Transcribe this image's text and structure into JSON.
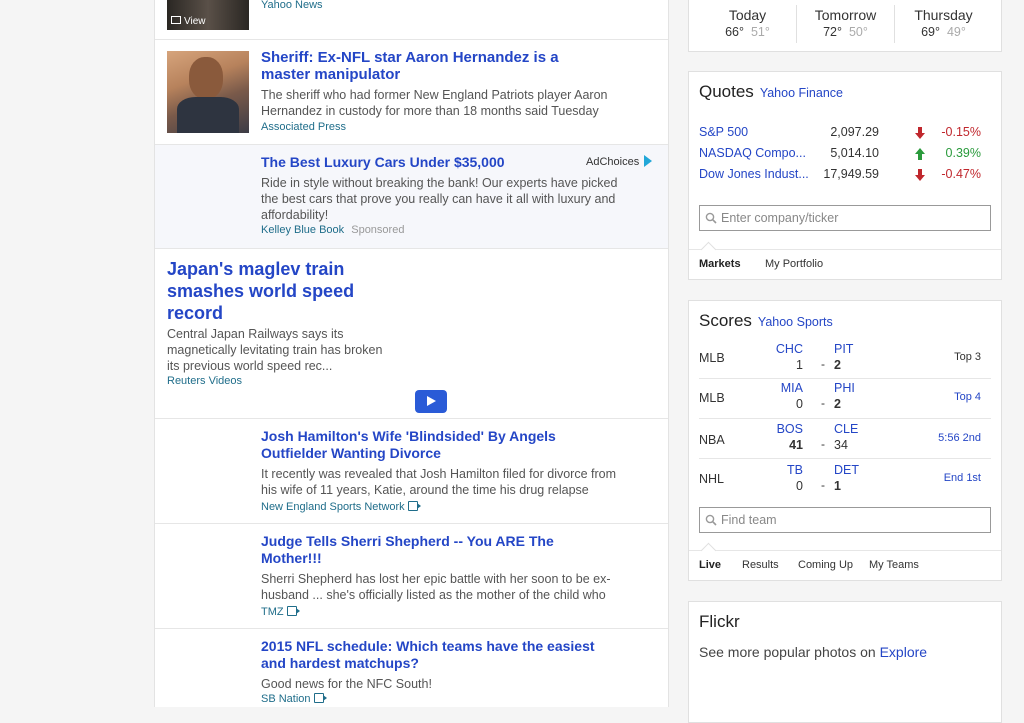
{
  "feed": {
    "top_item": {
      "source": "Yahoo News",
      "view_label": "View"
    },
    "item1": {
      "headline": "Sheriff: Ex-NFL star Aaron Hernandez is a master manipulator",
      "summary": "The sheriff who had former New England Patriots player Aaron Hernandez in custody for more than 18 months said Tuesday",
      "source": "Associated Press"
    },
    "ad": {
      "headline": "The Best Luxury Cars Under $35,000",
      "adchoices": "AdChoices",
      "summary": "Ride in style without breaking the bank! Our experts have picked the best cars that prove you really can have it all with luxury and affordability!",
      "source": "Kelley Blue Book",
      "sponsored": "Sponsored"
    },
    "video": {
      "headline": "Japan's maglev train smashes world speed record",
      "summary": "Central Japan Railways says its magnetically levitating train has broken its previous world speed rec...",
      "source": "Reuters Videos"
    },
    "item2": {
      "headline": "Josh Hamilton's Wife 'Blindsided' By Angels Outfielder Wanting Divorce",
      "summary": "It recently was revealed that Josh Hamilton filed for divorce from his wife of 11 years, Katie, around the time his drug relapse",
      "source": "New England Sports Network"
    },
    "item3": {
      "headline": "Judge Tells Sherri Shepherd -- You ARE The Mother!!!",
      "summary": "Sherri Shepherd has lost her epic battle with her soon to be ex-husband ... she's officially listed as the mother of the child who",
      "source": "TMZ"
    },
    "item4": {
      "headline": "2015 NFL schedule: Which teams have the easiest and hardest matchups?",
      "summary": "Good news for the NFC South!",
      "source": "SB Nation"
    }
  },
  "weather": {
    "days": [
      {
        "day": "Today",
        "high": "66°",
        "low": "51°"
      },
      {
        "day": "Tomorrow",
        "high": "72°",
        "low": "50°"
      },
      {
        "day": "Thursday",
        "high": "69°",
        "low": "49°"
      }
    ]
  },
  "quotes": {
    "title": "Quotes",
    "subtitle": "Yahoo Finance",
    "rows": [
      {
        "name": "S&P 500",
        "value": "2,097.29",
        "change": "-0.15%",
        "dir": "down"
      },
      {
        "name": "NASDAQ Compo...",
        "value": "5,014.10",
        "change": "0.39%",
        "dir": "up"
      },
      {
        "name": "Dow Jones Indust...",
        "value": "17,949.59",
        "change": "-0.47%",
        "dir": "down"
      }
    ],
    "search_placeholder": "Enter company/ticker",
    "tabs": [
      "Markets",
      "My Portfolio"
    ],
    "colors": {
      "down": "#c0272d",
      "up": "#2a9a3c"
    }
  },
  "scores": {
    "title": "Scores",
    "subtitle": "Yahoo Sports",
    "rows": [
      {
        "league": "MLB",
        "away": "CHC",
        "away_score": "1",
        "home": "PIT",
        "home_score": "2",
        "status": "Top 3"
      },
      {
        "league": "MLB",
        "away": "MIA",
        "away_score": "0",
        "home": "PHI",
        "home_score": "2",
        "status": "Top 4"
      },
      {
        "league": "NBA",
        "away": "BOS",
        "away_score": "41",
        "home": "CLE",
        "home_score": "34",
        "status": "5:56 2nd"
      },
      {
        "league": "NHL",
        "away": "TB",
        "away_score": "0",
        "home": "DET",
        "home_score": "1",
        "status": "End 1st"
      }
    ],
    "search_placeholder": "Find team",
    "tabs": [
      "Live",
      "Results",
      "Coming Up",
      "My Teams"
    ]
  },
  "flickr": {
    "title": "Flickr",
    "text": "See more popular photos on",
    "link": "Explore"
  }
}
